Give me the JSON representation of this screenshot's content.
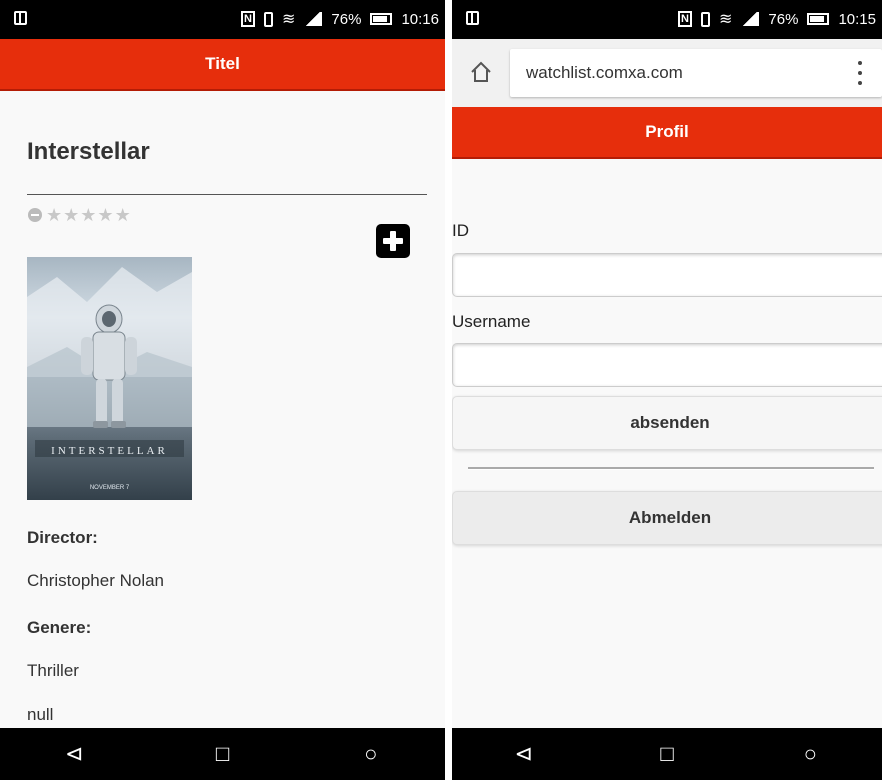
{
  "status_left": {
    "battery": "76%",
    "time": "10:16"
  },
  "status_right": {
    "battery": "76%",
    "time": "10:15"
  },
  "movie_page": {
    "header": "Titel",
    "title": "Interstellar",
    "rating_stars": 0,
    "rating_max": 5,
    "poster_text": "INTERSTELLAR",
    "poster_date": "NOVEMBER 7",
    "director_label": "Director:",
    "director": "Christopher Nolan",
    "genre_label": "Genere:",
    "genre": "Thriller",
    "extra": "null"
  },
  "profile_page": {
    "url": "watchlist.comxa.com",
    "header": "Profil",
    "id_label": "ID",
    "id_value": "",
    "username_label": "Username",
    "username_value": "",
    "submit_label": "absenden",
    "logout_label": "Abmelden"
  },
  "nav": {
    "back": "⊲",
    "home": "□",
    "recents": "○"
  },
  "colors": {
    "header_red": "#e62e0c",
    "status_black": "#000000",
    "background": "#f9f9f9"
  }
}
